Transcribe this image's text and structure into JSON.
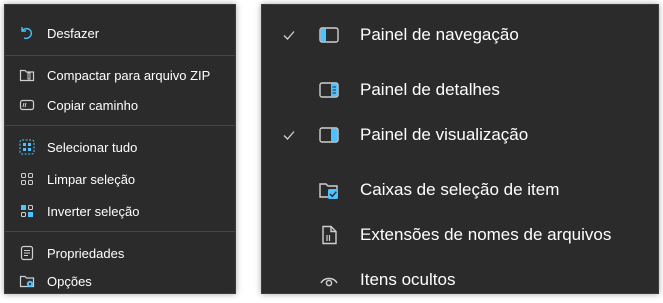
{
  "left_menu": {
    "items": [
      {
        "label": "Desfazer",
        "icon": "undo-icon"
      },
      {
        "label": "Compactar para arquivo ZIP",
        "icon": "zip-folder-icon"
      },
      {
        "label": "Copiar caminho",
        "icon": "copy-path-icon"
      },
      {
        "label": "Selecionar tudo",
        "icon": "select-all-icon"
      },
      {
        "label": "Limpar seleção",
        "icon": "clear-selection-icon"
      },
      {
        "label": "Inverter seleção",
        "icon": "invert-selection-icon"
      },
      {
        "label": "Propriedades",
        "icon": "properties-icon"
      },
      {
        "label": "Opções",
        "icon": "options-icon"
      }
    ]
  },
  "right_menu": {
    "items": [
      {
        "label": "Painel de navegação",
        "icon": "navigation-pane-icon",
        "checked": true
      },
      {
        "label": "Painel de detalhes",
        "icon": "details-pane-icon",
        "checked": false
      },
      {
        "label": "Painel de visualização",
        "icon": "preview-pane-icon",
        "checked": true
      },
      {
        "label": "Caixas de seleção de item",
        "icon": "item-checkboxes-icon",
        "checked": false
      },
      {
        "label": "Extensões de nomes de arquivos",
        "icon": "file-extensions-icon",
        "checked": false
      },
      {
        "label": "Itens ocultos",
        "icon": "hidden-items-icon",
        "checked": false
      }
    ]
  },
  "colors": {
    "menu_background": "#2b2b2b",
    "text": "#ffffff",
    "accent_blue": "#4cc2ff",
    "icon_gray": "#d0d0d0"
  }
}
